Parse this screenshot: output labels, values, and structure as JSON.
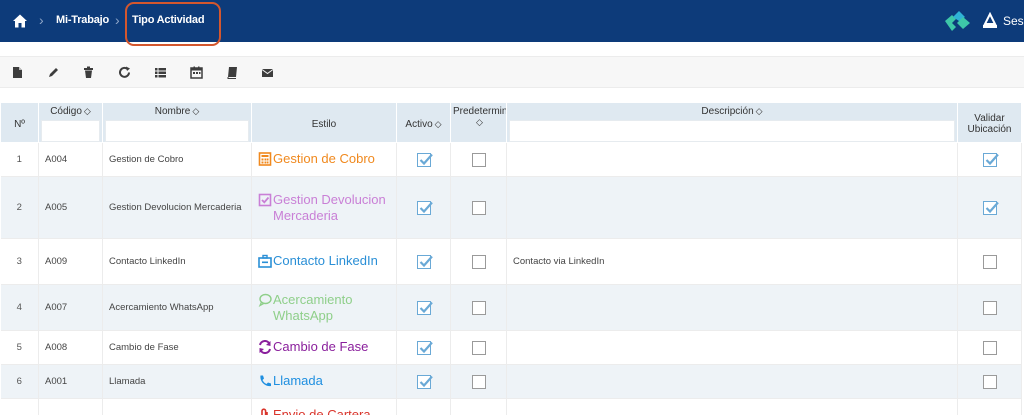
{
  "breadcrumb": {
    "items": [
      "Mi-Trabajo",
      "Tipo Actividad"
    ]
  },
  "user": {
    "label": "Ses"
  },
  "toolbar": {
    "icons": [
      "new-document-icon",
      "edit-icon",
      "delete-icon",
      "refresh-icon",
      "list-icon",
      "calendar-icon",
      "book-icon",
      "mail-icon"
    ]
  },
  "table": {
    "headers": {
      "num": "Nº",
      "codigo": "Código",
      "nombre": "Nombre",
      "estilo": "Estilo",
      "activo": "Activo",
      "predeterminado": "Predetermin",
      "descripcion": "Descripción",
      "validar": "Validar Ubicación"
    },
    "sort_symbol": "◇",
    "rows": [
      {
        "num": "1",
        "codigo": "A004",
        "nombre": "Gestion de Cobro",
        "estilo": "Gestion de Cobro",
        "estilo_color": "#f0891e",
        "estilo_icon": "calculator-icon",
        "activo": true,
        "predeterminado": false,
        "descripcion": "",
        "validar": true
      },
      {
        "num": "2",
        "codigo": "A005",
        "nombre": "Gestion Devolucion Mercaderia",
        "estilo": "Gestion Devolucion Mercaderia",
        "estilo_color": "#c97fd6",
        "estilo_icon": "check-square-icon",
        "activo": true,
        "predeterminado": false,
        "descripcion": "",
        "validar": true
      },
      {
        "num": "3",
        "codigo": "A009",
        "nombre": "Contacto LinkedIn",
        "estilo": "Contacto LinkedIn",
        "estilo_color": "#2a8fd6",
        "estilo_icon": "briefcase-icon",
        "activo": true,
        "predeterminado": false,
        "descripcion": "Contacto via LinkedIn",
        "validar": false
      },
      {
        "num": "4",
        "codigo": "A007",
        "nombre": "Acercamiento WhatsApp",
        "estilo": "Acercamiento WhatsApp",
        "estilo_color": "#8fcf8a",
        "estilo_icon": "chat-bubble-icon",
        "activo": true,
        "predeterminado": false,
        "descripcion": "",
        "validar": false
      },
      {
        "num": "5",
        "codigo": "A008",
        "nombre": "Cambio de Fase",
        "estilo": "Cambio de Fase",
        "estilo_color": "#8a1f9c",
        "estilo_icon": "cycle-arrows-icon",
        "activo": true,
        "predeterminado": false,
        "descripcion": "",
        "validar": false
      },
      {
        "num": "6",
        "codigo": "A001",
        "nombre": "Llamada",
        "estilo": "Llamada",
        "estilo_color": "#1f8fe0",
        "estilo_icon": "phone-icon",
        "activo": true,
        "predeterminado": false,
        "descripcion": "",
        "validar": false
      },
      {
        "num": "",
        "codigo": "",
        "nombre": "",
        "estilo": "Envio de Cartera",
        "estilo_color": "#d9342b",
        "estilo_icon": "paperclip-icon",
        "activo": false,
        "predeterminado": false,
        "descripcion": "",
        "validar": false
      }
    ]
  },
  "colors": {
    "topbar": "#0d3b7a",
    "header_bg": "#dfe9f1",
    "alt_row": "#eef3f7",
    "checkbox_on": "#6aa9d6",
    "highlight": "#d4572e"
  }
}
